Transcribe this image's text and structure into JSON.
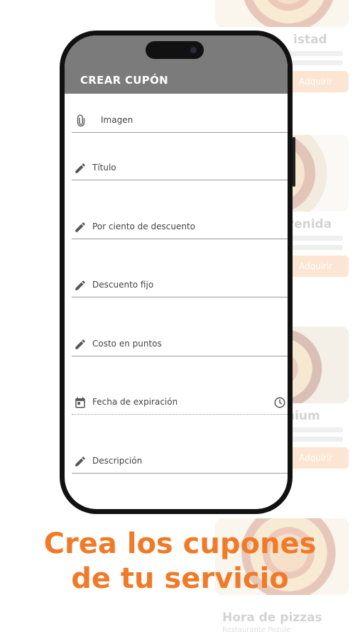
{
  "app": {
    "title": "CREAR CUPÓN"
  },
  "form": {
    "fields": [
      {
        "label": "Imagen",
        "icon": "attachment-icon"
      },
      {
        "label": "Título",
        "icon": "pencil-icon"
      },
      {
        "label": "Por ciento de descuento",
        "icon": "pencil-icon"
      },
      {
        "label": "Descuento fijo",
        "icon": "pencil-icon"
      },
      {
        "label": "Costo en puntos",
        "icon": "pencil-icon"
      },
      {
        "label": "Fecha de expiración",
        "icon": "calendar-icon",
        "trailing_icon": "clock-icon"
      },
      {
        "label": "Descripción",
        "icon": "pencil-icon"
      }
    ]
  },
  "tagline": {
    "line1": "Crea los cupones",
    "line2": "de tu servicio"
  },
  "background_cards": [
    {
      "title": "istad",
      "sub": "",
      "button": "Adquirir"
    },
    {
      "title": "venida",
      "sub": "",
      "button": "Adquirir"
    },
    {
      "title": "nium",
      "sub": "",
      "button": "Adquirir"
    },
    {
      "title": "Hora de pizzas",
      "sub": "Restaurante Pozole",
      "button": ""
    }
  ],
  "colors": {
    "appbar": "#7b7b7b",
    "accent": "#f07a28",
    "button_faded": "#f7b07a"
  }
}
